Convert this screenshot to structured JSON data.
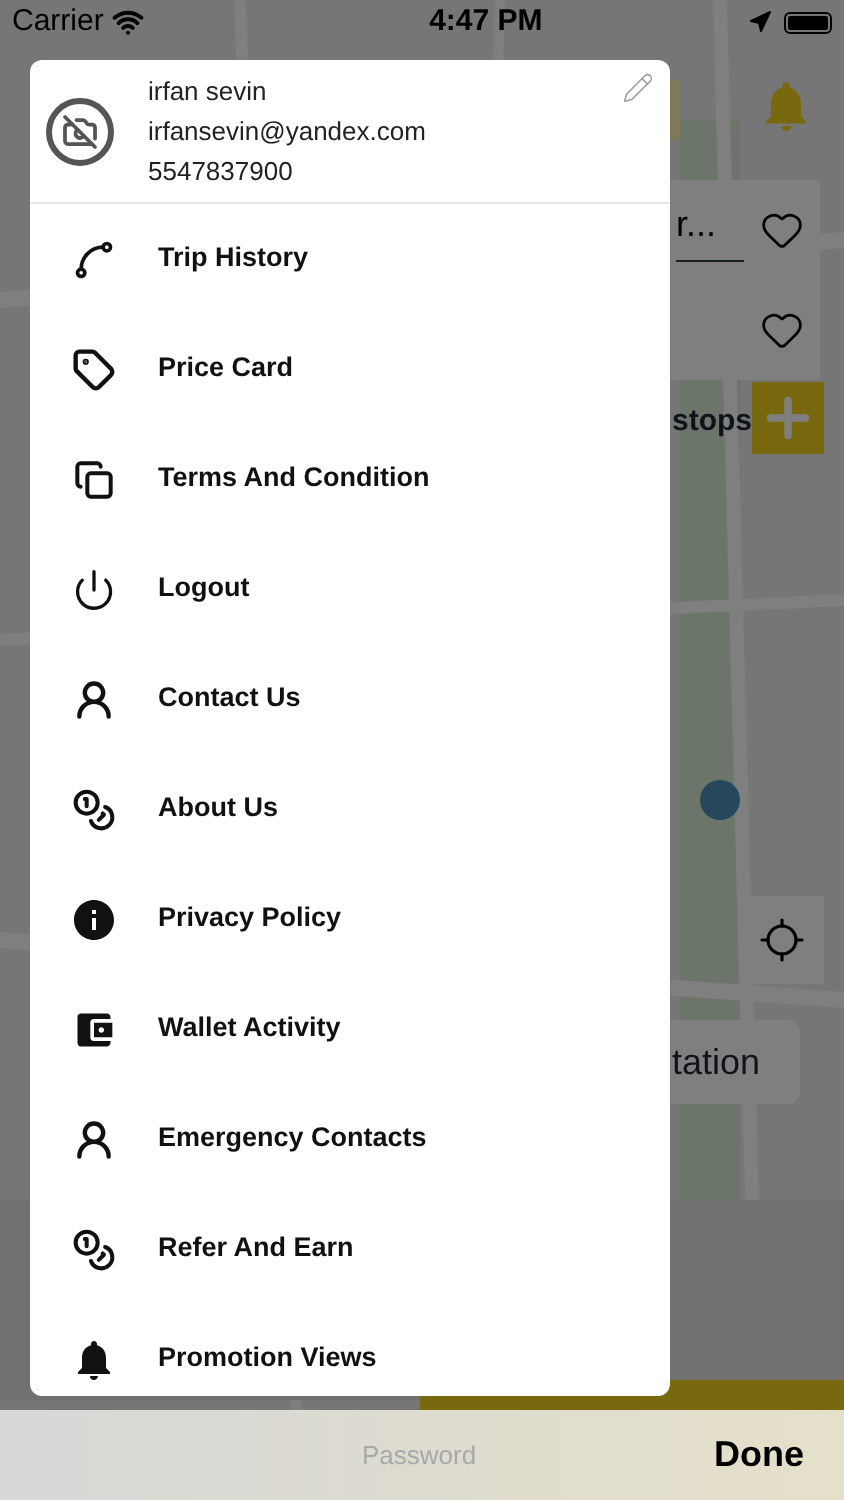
{
  "status_bar": {
    "carrier": "Carrier",
    "time": "4:47 PM"
  },
  "map_overlay": {
    "search_text": "r...",
    "stops_label": "stops",
    "location_button": "tation"
  },
  "drawer": {
    "profile": {
      "name": "irfan sevin",
      "email": "irfansevin@yandex.com",
      "phone": "5547837900"
    },
    "items": [
      {
        "label": "Trip History"
      },
      {
        "label": "Price Card"
      },
      {
        "label": "Terms And Condition"
      },
      {
        "label": "Logout"
      },
      {
        "label": "Contact Us"
      },
      {
        "label": "About Us"
      },
      {
        "label": "Privacy Policy"
      },
      {
        "label": "Wallet Activity"
      },
      {
        "label": "Emergency Contacts"
      },
      {
        "label": "Refer And Earn"
      },
      {
        "label": "Promotion Views"
      }
    ]
  },
  "keyboard_toolbar": {
    "placeholder": "Password",
    "done": "Done"
  }
}
